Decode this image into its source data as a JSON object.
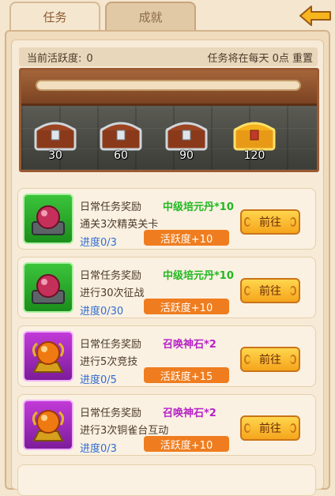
{
  "tabs": [
    {
      "label": "任务",
      "active": true
    },
    {
      "label": "成就",
      "active": false
    }
  ],
  "header": {
    "back_icon": "back-arrow-icon"
  },
  "summary": {
    "activity_label": "当前活跃度:",
    "activity_value": "0",
    "reset_text": "任务将在每天 0点 重置"
  },
  "progress": {
    "fraction": 0.0
  },
  "chests": [
    {
      "label": "30",
      "icon": "silver-chest-icon"
    },
    {
      "label": "60",
      "icon": "silver-chest-icon"
    },
    {
      "label": "90",
      "icon": "silver-chest-icon"
    },
    {
      "label": "120",
      "icon": "gold-chest-icon"
    }
  ],
  "tasks": [
    {
      "title": "日常任务奖励",
      "reward": "中级培元丹*10",
      "reward_color": "#21b821",
      "desc": "通关3次精英关卡",
      "progress": "进度0/3",
      "activity": "活跃度+10",
      "button": "前往",
      "icon": "red-pill-icon"
    },
    {
      "title": "日常任务奖励",
      "reward": "中级培元丹*10",
      "reward_color": "#21b821",
      "desc": "进行30次征战",
      "progress": "进度0/30",
      "activity": "活跃度+10",
      "button": "前往",
      "icon": "red-pill-icon"
    },
    {
      "title": "日常任务奖励",
      "reward": "召唤神石*2",
      "reward_color": "#b620c7",
      "desc": "进行5次竞技",
      "progress": "进度0/5",
      "activity": "活跃度+15",
      "button": "前往",
      "icon": "summon-stone-icon"
    },
    {
      "title": "日常任务奖励",
      "reward": "召唤神石*2",
      "reward_color": "#b620c7",
      "desc": "进行3次铜雀台互动",
      "progress": "进度0/3",
      "activity": "活跃度+10",
      "button": "前往",
      "icon": "summon-stone-icon"
    }
  ]
}
